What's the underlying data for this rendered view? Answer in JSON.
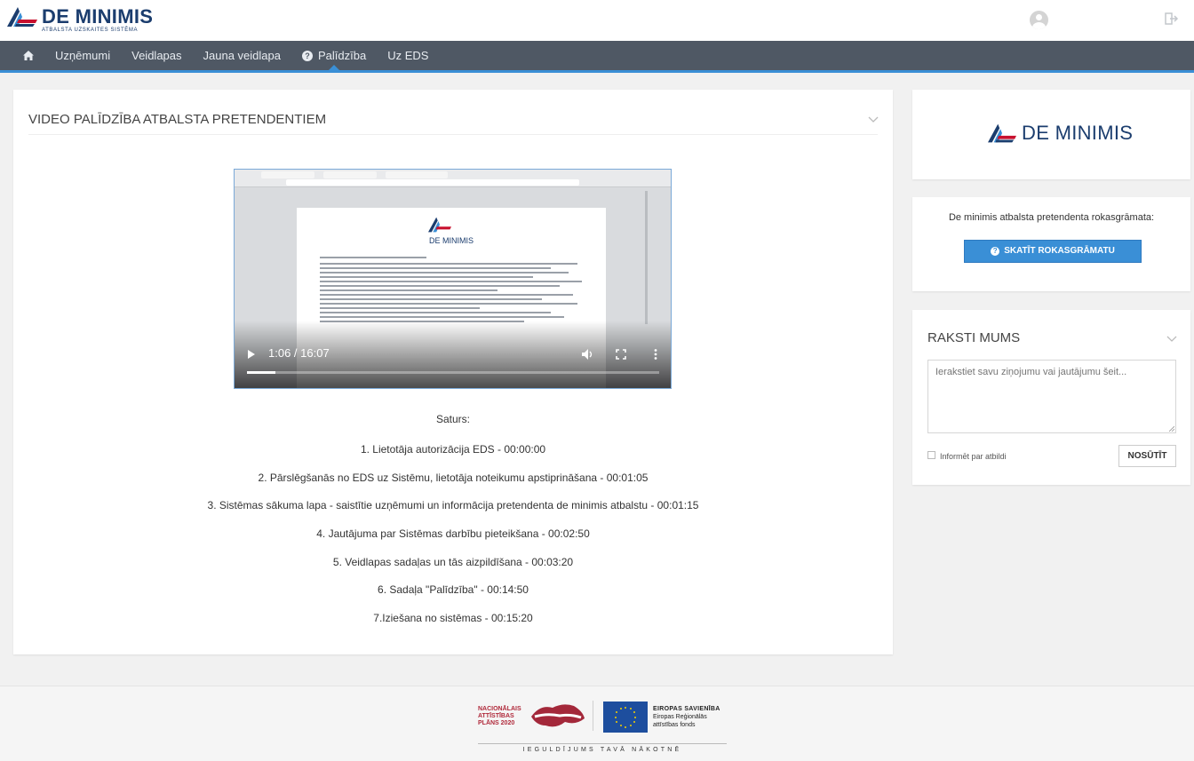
{
  "header": {
    "logo_title": "DE MINIMIS",
    "logo_subtitle": "ATBALSTA UZSKAITES SISTĒMA"
  },
  "nav": {
    "items": [
      {
        "label": "Uzņēmumi"
      },
      {
        "label": "Veidlapas"
      },
      {
        "label": "Jauna veidlapa"
      },
      {
        "label": "Palīdzība",
        "active": true
      },
      {
        "label": "Uz EDS"
      }
    ]
  },
  "main": {
    "title": "VIDEO PALĪDZĪBA ATBALSTA PRETENDENTIEM",
    "video": {
      "time": "1:06 / 16:07",
      "doc_logo_text": "DE MINIMIS",
      "progress_fraction": 0.068
    },
    "contents_heading": "Saturs:",
    "contents": [
      "1. Lietotāja autorizācija EDS - 00:00:00",
      "2. Pārslēgšanās no EDS uz Sistēmu, lietotāja noteikumu apstiprināšana - 00:01:05",
      "3. Sistēmas sākuma lapa - saistītie uzņēmumi un informācija pretendenta de minimis atbalstu - 00:01:15",
      "4. Jautājuma par Sistēmas darbību pieteikšana - 00:02:50",
      "5. Veidlapas sadaļas un tās aizpildīšana - 00:03:20",
      "6. Sadaļa \"Palīdzība\" - 00:14:50",
      "7.Iziešana no sistēmas - 00:15:20"
    ]
  },
  "sidebar": {
    "logo_text": "DE MINIMIS",
    "manual_text": "De minimis atbalsta pretendenta rokasgrāmata:",
    "manual_button": "SKATĪT ROKASGRĀMATU",
    "write_title": "RAKSTI MUMS",
    "write_placeholder": "Ierakstiet savu ziņojumu vai jautājumu šeit...",
    "notify_label": "Informēt par atbildi",
    "send_button": "NOSŪTĪT"
  },
  "footer": {
    "nap_lines": [
      "NACIONĀLAIS",
      "ATTĪSTĪBAS",
      "PLĀNS 2020"
    ],
    "eu_title": "EIROPAS SAVIENĪBA",
    "eu_lines": [
      "Eiropas Reģionālās",
      "attīstības fonds"
    ],
    "motto": "IEGULDĪJUMS TAVĀ NĀKOTNĒ"
  },
  "colors": {
    "nav_bg": "#4f5864",
    "accent": "#3a8fd6",
    "brand": "#1b3d6e",
    "nap_red": "#b02a3b",
    "eu_blue": "#1d4e9e"
  }
}
